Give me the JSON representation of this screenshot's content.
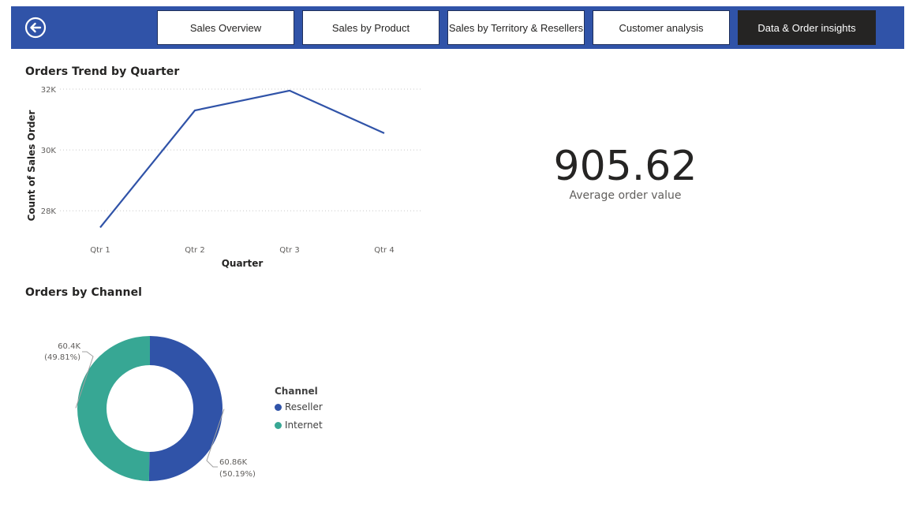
{
  "nav": {
    "tabs": [
      {
        "label": "Sales Overview",
        "active": false
      },
      {
        "label": "Sales by Product",
        "active": false
      },
      {
        "label": "Sales by Territory & Resellers",
        "active": false
      },
      {
        "label": "Customer analysis",
        "active": false
      },
      {
        "label": "Data & Order insights",
        "active": true
      }
    ],
    "back_icon": "back-arrow-circle-icon",
    "colors": {
      "bar": "#3053a8",
      "active_tab": "#252423"
    }
  },
  "kpi": {
    "value": "905.62",
    "label": "Average order value"
  },
  "legend": {
    "title": "Channel",
    "items": [
      "Reseller",
      "Internet"
    ]
  },
  "chart_data": [
    {
      "type": "line",
      "title": "Orders Trend by Quarter",
      "xlabel": "Quarter",
      "ylabel": "Count of Sales Order",
      "categories": [
        "Qtr 1",
        "Qtr 2",
        "Qtr 3",
        "Qtr 4"
      ],
      "series": [
        {
          "values": [
            27450,
            31300,
            31950,
            30550
          ],
          "color": "#3053a8"
        }
      ],
      "yticks": [
        28000,
        30000,
        32000
      ],
      "ytick_labels": [
        "28K",
        "30K",
        "32K"
      ],
      "ylim": [
        27300,
        32050
      ],
      "grid": true
    },
    {
      "type": "pie",
      "donut": true,
      "title": "Orders by Channel",
      "legend_title": "Channel",
      "legend_position": "right",
      "slices": [
        {
          "name": "Reseller",
          "value": 60860,
          "label": "60.86K",
          "percent_label": "(50.19%)",
          "color": "#3053a8"
        },
        {
          "name": "Internet",
          "value": 60400,
          "label": "60.4K",
          "percent_label": "(49.81%)",
          "color": "#37a794"
        }
      ]
    }
  ]
}
